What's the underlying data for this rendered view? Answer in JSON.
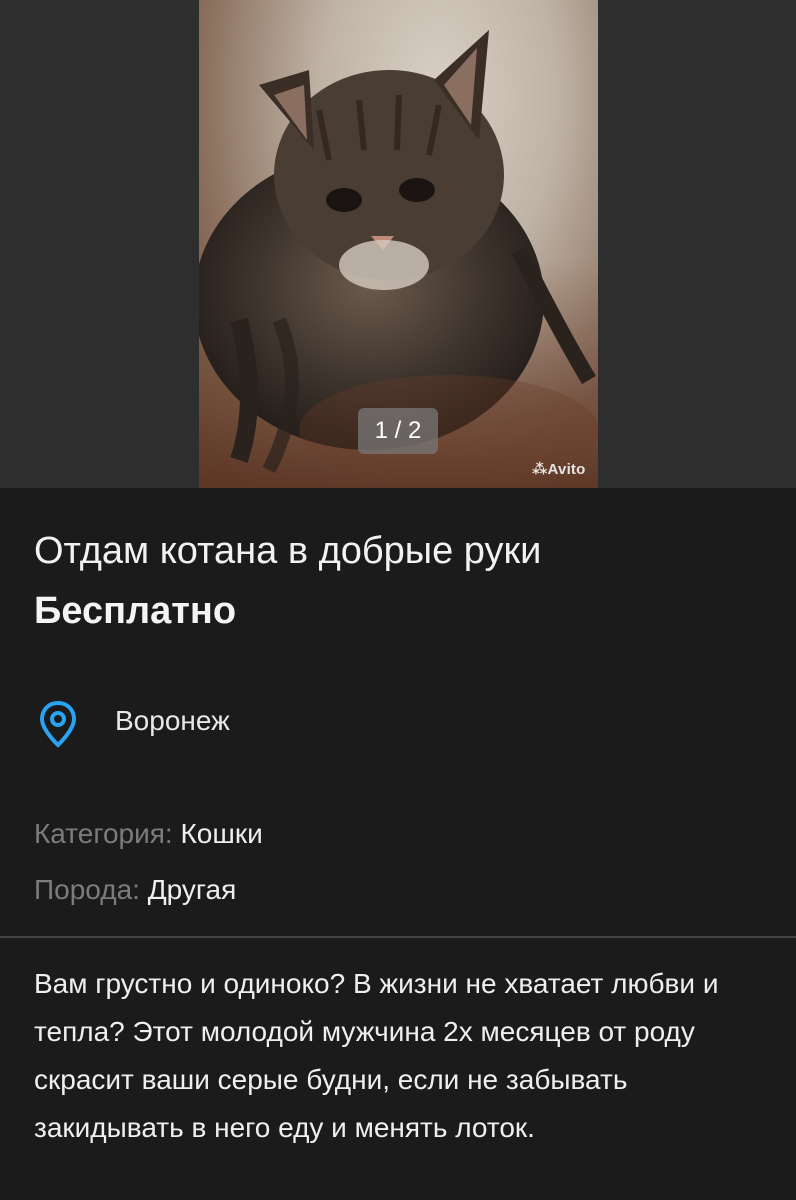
{
  "gallery": {
    "counter": "1 / 2",
    "watermark": "Avito"
  },
  "listing": {
    "title": "Отдам котана в добрые руки",
    "price": "Бесплатно",
    "location": "Воронеж",
    "params": [
      {
        "key": "Категория:",
        "value": "Кошки"
      },
      {
        "key": "Порода:",
        "value": "Другая"
      }
    ],
    "description": "Вам грустно и одиноко? В жизни не хватает любви и тепла? Этот молодой мужчина 2х месяцев от роду скрасит ваши серые будни, если не забывать закидывать в него еду и менять лоток."
  },
  "colors": {
    "background": "#1b1b1b",
    "accent_icon": "#2aa3f4"
  },
  "icons": {
    "location": "map-pin-icon"
  }
}
